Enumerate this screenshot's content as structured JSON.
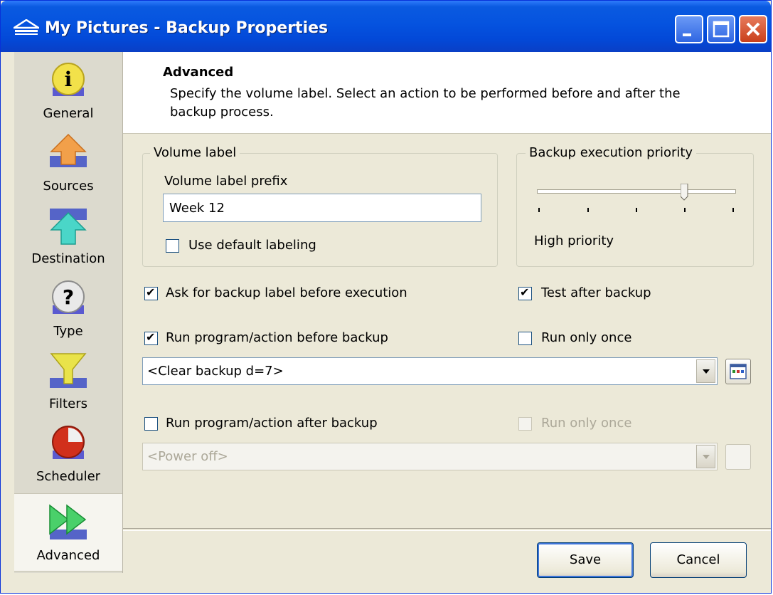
{
  "window": {
    "title": "My Pictures - Backup Properties"
  },
  "sidebar": {
    "items": [
      {
        "label": "General",
        "icon": "info-icon"
      },
      {
        "label": "Sources",
        "icon": "upload-arrow-icon"
      },
      {
        "label": "Destination",
        "icon": "destination-arrow-icon"
      },
      {
        "label": "Type",
        "icon": "question-icon"
      },
      {
        "label": "Filters",
        "icon": "filter-funnel-icon"
      },
      {
        "label": "Scheduler",
        "icon": "clock-pie-icon"
      },
      {
        "label": "Advanced",
        "icon": "fast-forward-icon"
      }
    ],
    "active": "Advanced"
  },
  "header": {
    "title": "Advanced",
    "description": "Specify the volume label. Select an action to be performed before and after the backup process."
  },
  "volume_label": {
    "group_title": "Volume label",
    "prefix_label": "Volume label prefix",
    "prefix_value": "Week 12",
    "use_default_label": "Use default labeling",
    "use_default_checked": false
  },
  "priority": {
    "group_title": "Backup execution priority",
    "level_text": "High priority",
    "level_fraction": 0.75
  },
  "options": {
    "ask_label": "Ask for backup label before execution",
    "ask_checked": true,
    "test_after_label": "Test after backup",
    "test_after_checked": true,
    "run_before_label": "Run program/action before backup",
    "run_before_checked": true,
    "run_once_before_label": "Run only once",
    "run_once_before_checked": false,
    "before_action_value": "<Clear backup d=7>",
    "run_after_label": "Run program/action after backup",
    "run_after_checked": false,
    "run_once_after_label": "Run only once",
    "run_once_after_checked": false,
    "after_action_value": "<Power off>"
  },
  "buttons": {
    "save": "Save",
    "cancel": "Cancel"
  },
  "colors": {
    "titlebar": "#0553df",
    "panel": "#ece9d8",
    "accent": "#3c74d8"
  }
}
